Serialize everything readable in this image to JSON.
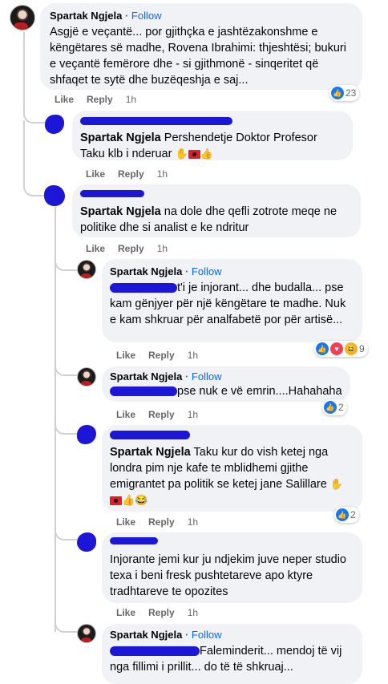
{
  "comments": [
    {
      "author": "Spartak Ngjela",
      "follow": "Follow",
      "text": "Asgjë e veçantë... por gjithçka e jashtëzakonshme e këngëtares së madhe, Rovena Ibrahimi: thjeshtësi; bukuri e veçantë femërore dhe - si gjithmonë - sinqeritet që shfaqet te sytë dhe buzëqeshja e saj...",
      "like": "Like",
      "reply": "Reply",
      "time": "1h",
      "reactions": "23"
    },
    {
      "author": "Spartak Ngjela",
      "text": "Pershendetje Doktor Profesor Taku klb i nderuar",
      "like": "Like",
      "reply": "Reply",
      "time": "1h"
    },
    {
      "author": "Spartak Ngjela",
      "text": "na dole dhe qefli zotrote meqe ne politike dhe si analist e ke ndritur",
      "like": "Like",
      "reply": "Reply",
      "time": "1h"
    },
    {
      "author": "Spartak Ngjela",
      "follow": "Follow",
      "text_after": "t'i je injorant... dhe budalla... pse kam gënjyer për një këngëtare te madhe. Nuk e kam shkruar për analfabetë por për artisë...",
      "like": "Like",
      "reply": "Reply",
      "time": "1h",
      "reactions": "9"
    },
    {
      "author": "Spartak Ngjela",
      "follow": "Follow",
      "text_after": "pse nuk e vë emrin....Hahahaha",
      "like": "Like",
      "reply": "Reply",
      "time": "1h",
      "reactions": "2"
    },
    {
      "author": "Spartak Ngjela",
      "text": "Taku kur do vish ketej nga londra pim nje kafe te mblidhemi gjithe emigrantet pa politik se ketej jane Salillare",
      "like": "Like",
      "reply": "Reply",
      "time": "1h",
      "reactions": "2"
    },
    {
      "text": "Injorante jemi kur ju ndjekim juve neper studio texa i beni fresk pushtetareve apo ktyre tradhtareve te opozites",
      "like": "Like",
      "reply": "Reply",
      "time": "1h"
    },
    {
      "author": "Spartak Ngjela",
      "follow": "Follow",
      "text_after": "Faleminderit... mendoj të vij",
      "text_line2": "nga fillimi i prillit... do të të shkruaj..."
    }
  ],
  "separator": "·"
}
